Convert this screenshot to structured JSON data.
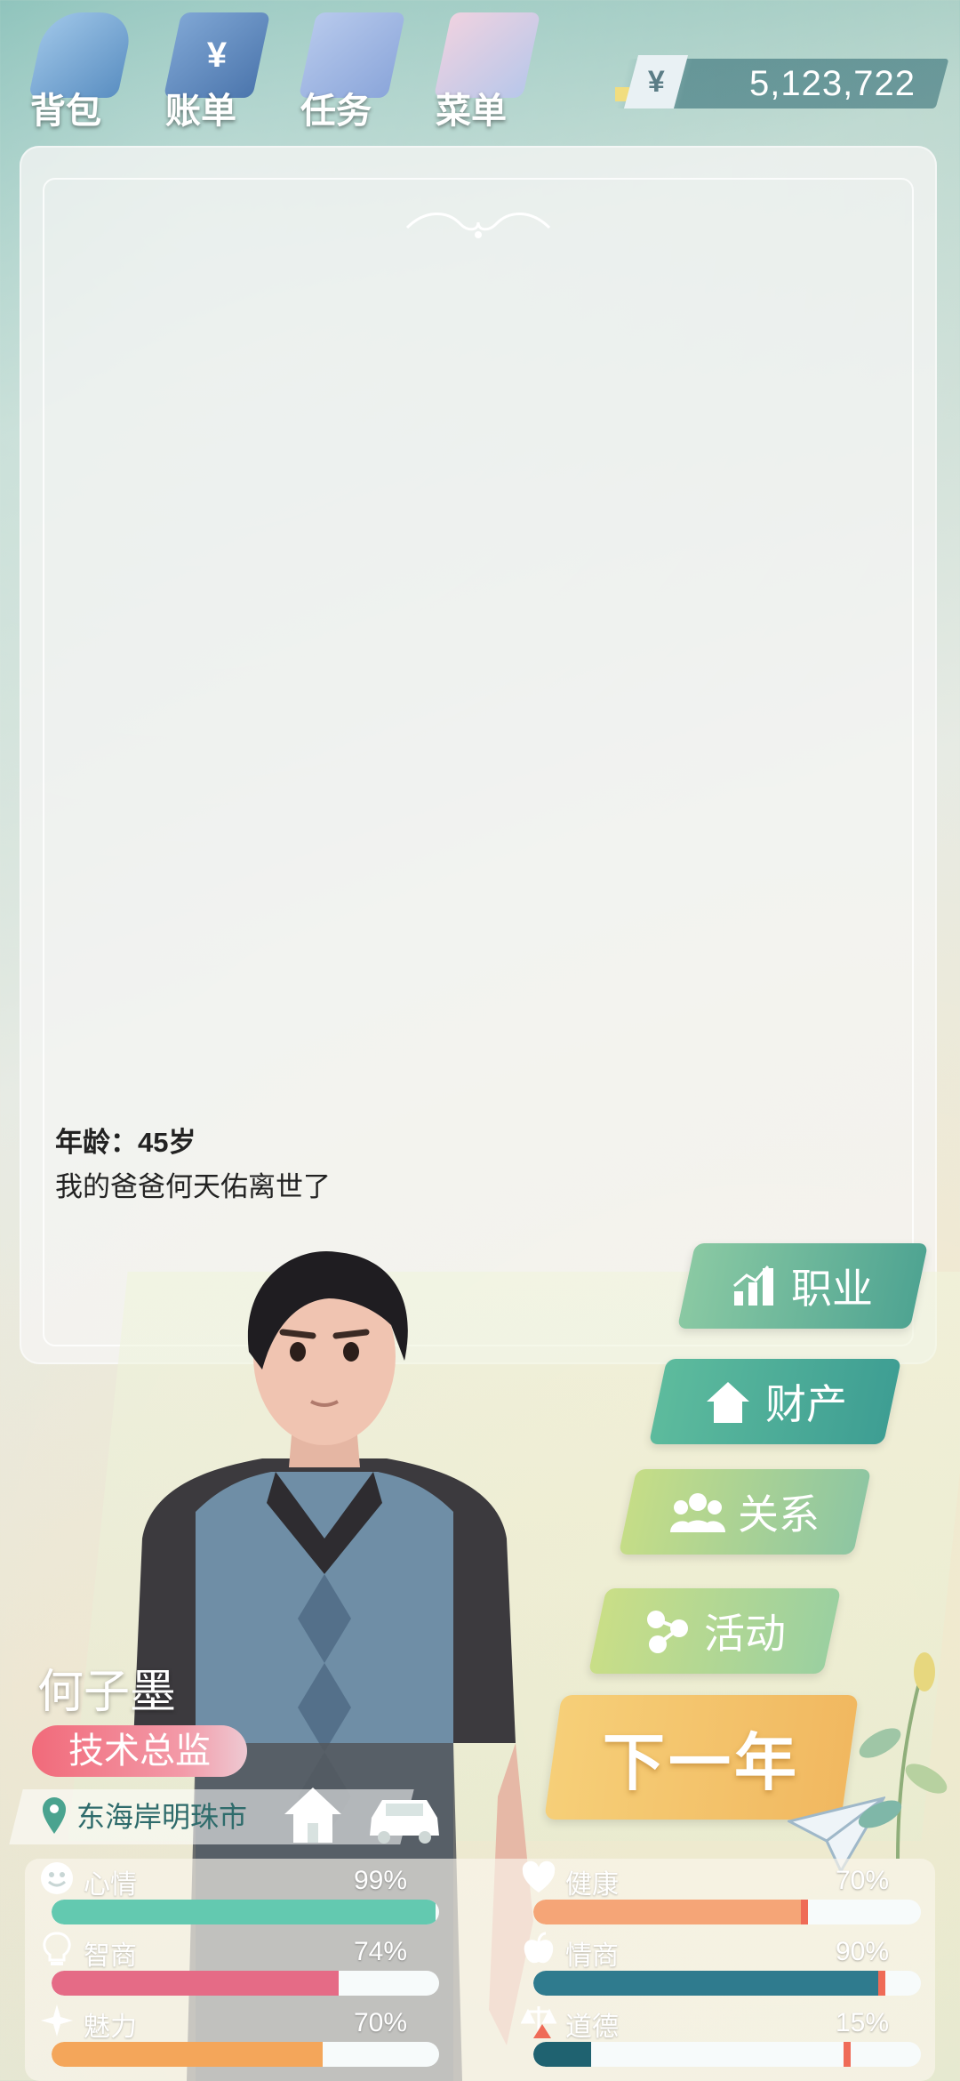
{
  "nav": [
    {
      "id": "bag",
      "label": "背包",
      "glyph": ""
    },
    {
      "id": "bill",
      "label": "账单",
      "glyph": "¥"
    },
    {
      "id": "task",
      "label": "任务",
      "glyph": ""
    },
    {
      "id": "menu",
      "label": "菜单",
      "glyph": ""
    }
  ],
  "money": {
    "symbol": "¥",
    "amount": "5,123,722"
  },
  "log": {
    "age_line": "年龄：45岁",
    "event": "我的爸爸何天佑离世了"
  },
  "character": {
    "name": "何子墨",
    "job": "技术总监",
    "location": "东海岸明珠市"
  },
  "actions": {
    "career": "职业",
    "property": "财产",
    "relation": "关系",
    "activity": "活动",
    "next_year": "下一年"
  },
  "stats": {
    "mood": {
      "label": "心情",
      "pct_text": "99%",
      "value": 99,
      "color": "#63c9b0"
    },
    "iq": {
      "label": "智商",
      "pct_text": "74%",
      "value": 74,
      "color": "#e56b86"
    },
    "charm": {
      "label": "魅力",
      "pct_text": "70%",
      "value": 70,
      "color": "#f4a65a"
    },
    "health": {
      "label": "健康",
      "pct_text": "70%",
      "value": 70,
      "color": "#f5a577"
    },
    "eq": {
      "label": "情商",
      "pct_text": "90%",
      "value": 90,
      "color": "#2f7b8e"
    },
    "morality": {
      "label": "道德",
      "pct_text": "15%",
      "value": 15,
      "color": "#1f6270"
    }
  }
}
